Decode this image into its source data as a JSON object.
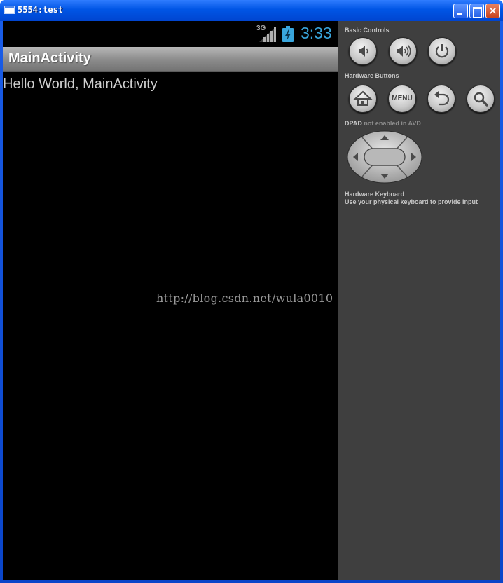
{
  "window": {
    "title": "5554:test",
    "close_glyph": "×",
    "icons": [
      "app-window-icon",
      "minimize-icon",
      "maximize-icon",
      "close-icon"
    ]
  },
  "status_bar": {
    "network": "3G",
    "time": "3:33",
    "time_color": "#39a6dd",
    "icons": [
      "signal-icon",
      "battery-charging-icon"
    ]
  },
  "action_bar": {
    "title": "MainActivity"
  },
  "content": {
    "text": "Hello World, MainActivity"
  },
  "controls": {
    "basic_label": "Basic Controls",
    "basic_buttons": [
      "volume-down-icon",
      "volume-up-icon",
      "power-icon"
    ],
    "hardware_label": "Hardware Buttons",
    "hardware_buttons": [
      "home-icon",
      "MENU",
      "back-icon",
      "search-icon"
    ],
    "menu_label": "MENU",
    "dpad_label": "DPAD",
    "dpad_note": "not enabled in AVD",
    "keyboard_label": "Hardware Keyboard",
    "keyboard_note": "Use your physical keyboard to provide input"
  },
  "watermark": "http://blog.csdn.net/wula0010"
}
